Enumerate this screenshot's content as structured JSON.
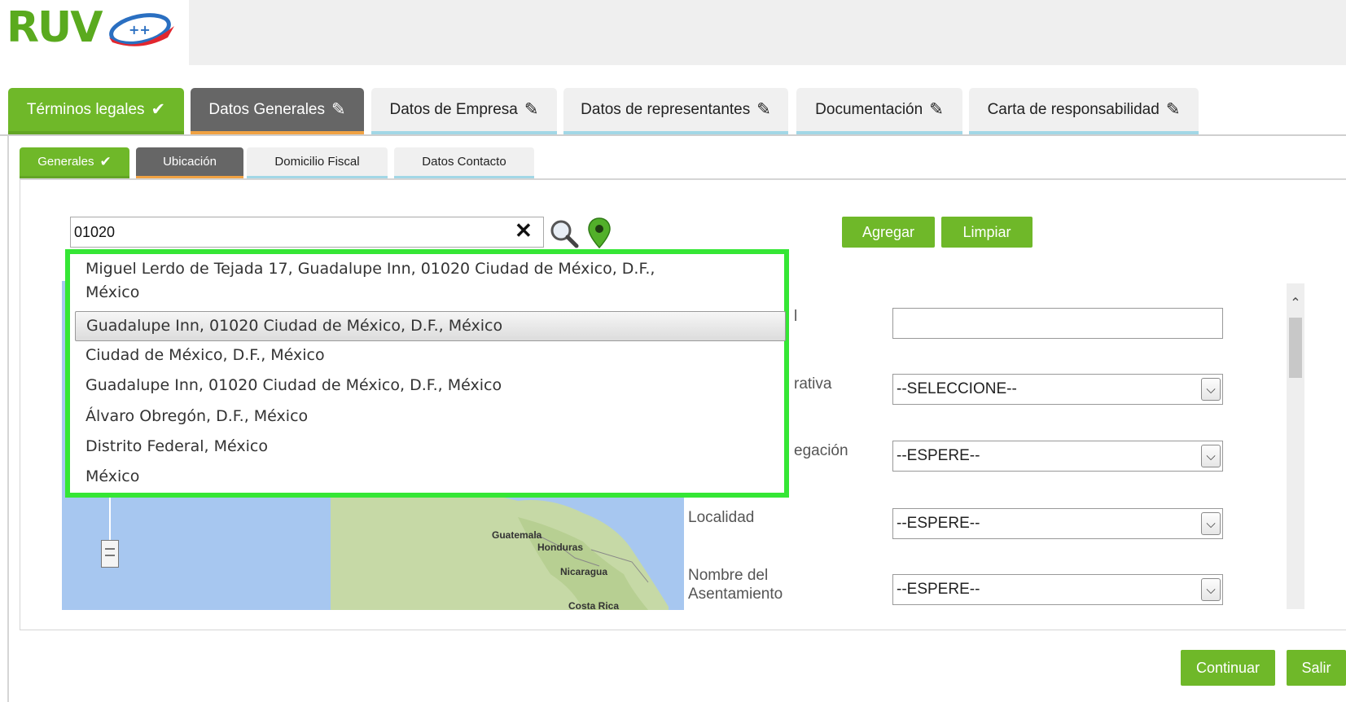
{
  "tabs": [
    {
      "label": "Términos legales",
      "icon": "check-icon",
      "state": "done"
    },
    {
      "label": "Datos Generales",
      "icon": "pencil-icon",
      "state": "active"
    },
    {
      "label": "Datos de Empresa",
      "icon": "pencil-icon",
      "state": "pending"
    },
    {
      "label": "Datos de representantes",
      "icon": "pencil-icon",
      "state": "pending"
    },
    {
      "label": "Documentación",
      "icon": "pencil-icon",
      "state": "pending"
    },
    {
      "label": "Carta de responsabilidad",
      "icon": "pencil-icon",
      "state": "pending"
    }
  ],
  "subtabs": [
    {
      "label": "Generales",
      "icon": "check-icon",
      "state": "done"
    },
    {
      "label": "Ubicación",
      "state": "active"
    },
    {
      "label": "Domicilio Fiscal",
      "state": "pending"
    },
    {
      "label": "Datos Contacto",
      "state": "pending"
    }
  ],
  "logo": {
    "text": "RUV",
    "badge": "++"
  },
  "search": {
    "value": "01020"
  },
  "buttons": {
    "agregar": "Agregar",
    "limpiar": "Limpiar",
    "continuar": "Continuar",
    "salir": "Salir"
  },
  "suggestions": [
    {
      "line1": "Miguel Lerdo de Tejada 17, Guadalupe Inn, 01020 Ciudad de México, D.F.,",
      "line2": "México"
    },
    {
      "line1": "Guadalupe Inn, 01020 Ciudad de México, D.F., México",
      "highlighted": true
    },
    {
      "line1": "Ciudad de México, D.F., México"
    },
    {
      "line1": "Guadalupe Inn, 01020 Ciudad de México, D.F., México"
    },
    {
      "line1": "Álvaro Obregón, D.F., México"
    },
    {
      "line1": "Distrito Federal, México"
    },
    {
      "line1": "México"
    }
  ],
  "form": {
    "label_partial_1": "l",
    "label_partial_2": "rativa",
    "label_partial_3": "egación",
    "localidad_label": "Localidad",
    "asentamiento_label_1": "Nombre del",
    "asentamiento_label_2": "Asentamiento",
    "select_entidad": "--SELECCIONE--",
    "select_municipio": "--ESPERE--",
    "select_localidad": "--ESPERE--",
    "select_asentamiento": "--ESPERE--"
  },
  "map_labels": [
    "Guatemala",
    "Honduras",
    "Nicaragua",
    "Costa Rica"
  ],
  "colors": {
    "green": "#6fb829",
    "active_tab": "#666666",
    "tab_accent": "#f0a243",
    "tab_underline": "#a2d7e6",
    "highlight_border": "#35e635",
    "map_water": "#a7c7f0"
  }
}
